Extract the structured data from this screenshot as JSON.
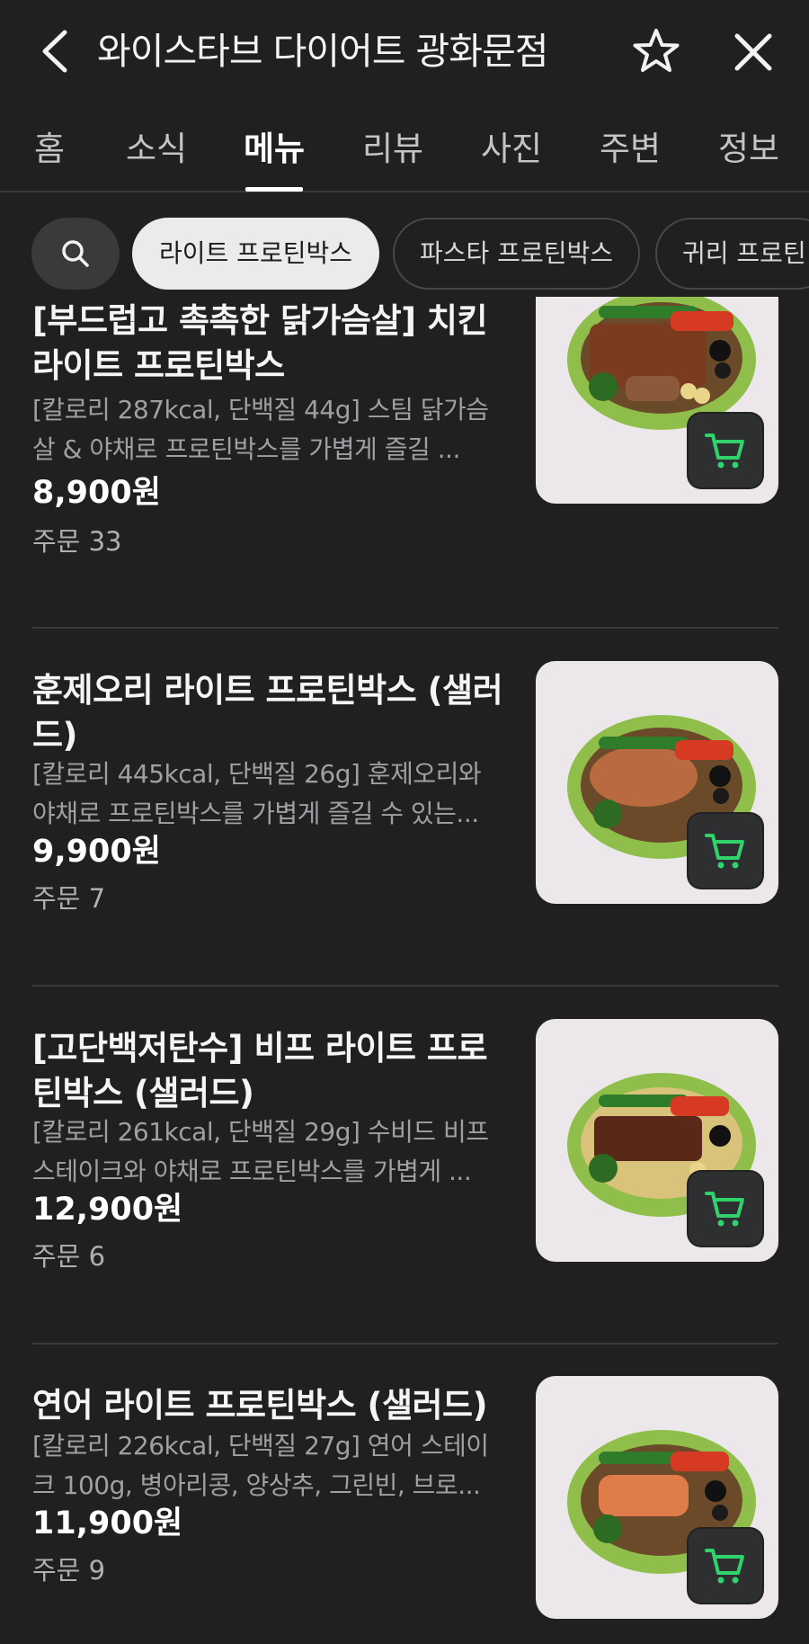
{
  "header": {
    "title": "와이스타브 다이어트 광화문점"
  },
  "tabs": [
    {
      "label": "홈"
    },
    {
      "label": "소식"
    },
    {
      "label": "메뉴"
    },
    {
      "label": "리뷰"
    },
    {
      "label": "사진"
    },
    {
      "label": "주변"
    },
    {
      "label": "정보"
    }
  ],
  "active_tab": "메뉴",
  "chips": [
    {
      "label": "라이트 프로틴박스"
    },
    {
      "label": "파스타 프로틴박스"
    },
    {
      "label": "귀리 프로틴"
    }
  ],
  "menu_items": [
    {
      "name": "[부드럽고 촉촉한 닭가슴살] 치킨 라이트 프로틴박스",
      "description": "[칼로리 287kcal, 단백질 44g] 스팀 닭가슴살 & 야채로 프로틴박스를 가볍게 즐길 ...",
      "price": "8,900원",
      "orders": "주문 33"
    },
    {
      "name": "훈제오리 라이트 프로틴박스 (샐러드)",
      "description": "[칼로리 445kcal, 단백질 26g] 훈제오리와 야채로 프로틴박스를 가볍게 즐길 수 있는...",
      "price": "9,900원",
      "orders": "주문 7"
    },
    {
      "name": "[고단백저탄수] 비프 라이트 프로틴박스 (샐러드)",
      "description": "[칼로리 261kcal, 단백질 29g] 수비드 비프 스테이크와 야채로 프로틴박스를 가볍게 ...",
      "price": "12,900원",
      "orders": "주문 6"
    },
    {
      "name": "연어 라이트 프로틴박스 (샐러드)",
      "description": "[칼로리 226kcal, 단백질 27g] 연어 스테이크 100g, 병아리콩, 양상추, 그린빈, 브로...",
      "price": "11,900원",
      "orders": "주문 9"
    }
  ],
  "colors": {
    "background": "#202021",
    "cart_icon": "#2fd26b",
    "chip_active_bg": "#ebebeb"
  },
  "icons": [
    "back-arrow-icon",
    "star-icon",
    "close-icon",
    "search-icon",
    "cart-icon"
  ]
}
